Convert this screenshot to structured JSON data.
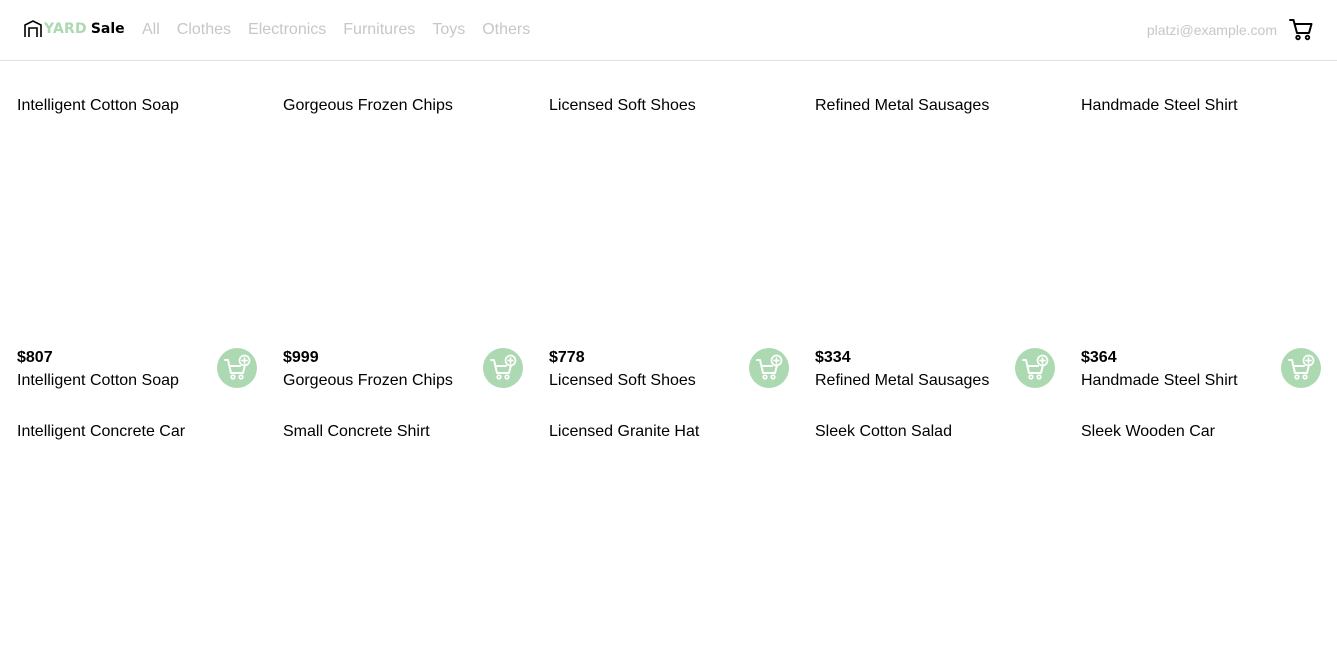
{
  "brand": {
    "part1": "YARD",
    "part2": "Sale"
  },
  "nav": {
    "links": [
      "All",
      "Clothes",
      "Electronics",
      "Furnitures",
      "Toys",
      "Others"
    ],
    "email": "platzi@example.com"
  },
  "colors": {
    "accent": "#acd9b2",
    "muted_text": "#c7c7c7",
    "divider": "#e0e0e0"
  },
  "icons": {
    "logo": "storefront-icon",
    "cart": "shopping-cart-icon",
    "add": "add-to-cart-icon"
  },
  "products": [
    {
      "name": "Intelligent Cotton Soap",
      "price": "$807",
      "alt": "Intelligent Cotton Soap"
    },
    {
      "name": "Gorgeous Frozen Chips",
      "price": "$999",
      "alt": "Gorgeous Frozen Chips"
    },
    {
      "name": "Licensed Soft Shoes",
      "price": "$778",
      "alt": "Licensed Soft Shoes"
    },
    {
      "name": "Refined Metal Sausages",
      "price": "$334",
      "alt": "Refined Metal Sausages"
    },
    {
      "name": "Handmade Steel Shirt",
      "price": "$364",
      "alt": "Handmade Steel Shirt"
    },
    {
      "name": "",
      "price": "",
      "alt": "Intelligent Concrete Car"
    },
    {
      "name": "",
      "price": "",
      "alt": "Small Concrete Shirt"
    },
    {
      "name": "",
      "price": "",
      "alt": "Licensed Granite Hat"
    },
    {
      "name": "",
      "price": "",
      "alt": "Sleek Cotton Salad"
    },
    {
      "name": "",
      "price": "",
      "alt": "Sleek Wooden Car"
    }
  ]
}
